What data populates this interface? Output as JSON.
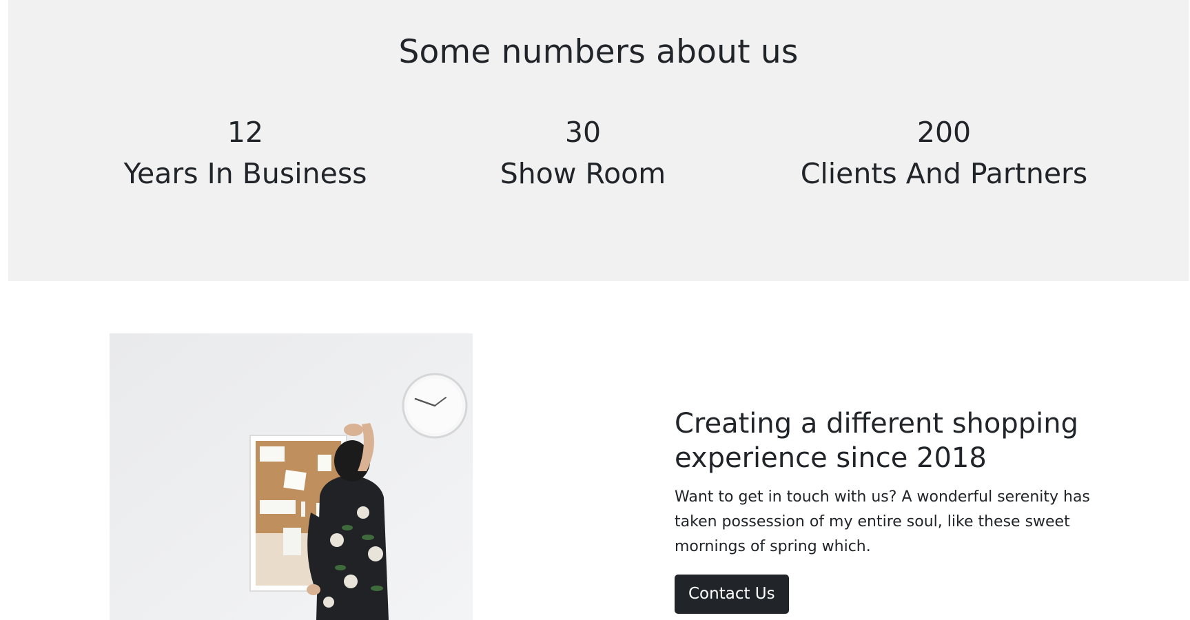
{
  "numbers": {
    "title": "Some numbers about us",
    "stats": [
      {
        "value": "12",
        "label": "Years In Business"
      },
      {
        "value": "30",
        "label": "Show Room"
      },
      {
        "value": "200",
        "label": "Clients And Partners"
      }
    ]
  },
  "feature": {
    "heading": "Creating a different shopping experience since 2018",
    "body": "Want to get in touch with us? A wonderful serenity has taken possession of my entire soul, like these sweet mornings of spring which.",
    "button_label": "Contact Us",
    "image_subject": "man-pinning-notes-on-corkboard-photo"
  },
  "colors": {
    "section_bg": "#f1f1f1",
    "text": "#212529",
    "button_bg": "#212529",
    "button_text": "#ffffff"
  }
}
